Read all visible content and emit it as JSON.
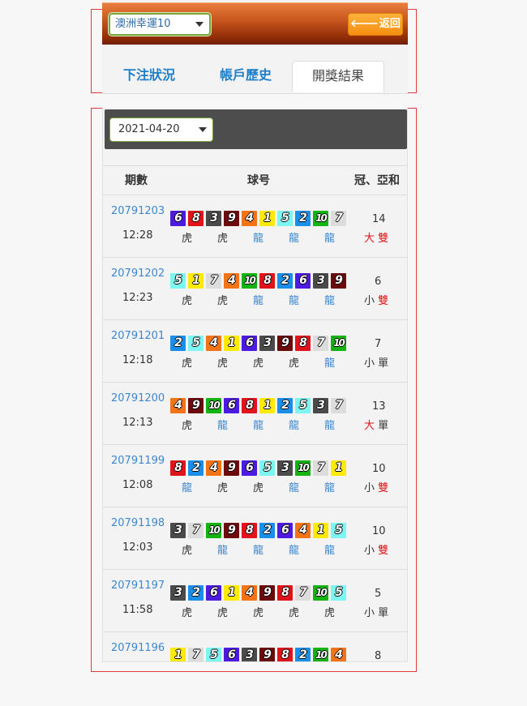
{
  "header": {
    "lottery_select": "澳洲幸運10",
    "back_label": "返回"
  },
  "tabs": [
    {
      "label": "下注狀況"
    },
    {
      "label": "帳戶歷史"
    },
    {
      "label": "開獎結果"
    }
  ],
  "toolbar": {
    "date_value": "2021-04-20"
  },
  "table": {
    "headers": {
      "period": "期數",
      "balls": "球号",
      "sum": "冠、亞和"
    },
    "rows": [
      {
        "period": "20791203",
        "time": "12:28",
        "balls": [
          6,
          8,
          3,
          9,
          4,
          1,
          5,
          2,
          10,
          7
        ],
        "dt": [
          "虎",
          "虎",
          "龍",
          "龍",
          "龍"
        ],
        "sum": "14",
        "size": "大",
        "oe": "雙"
      },
      {
        "period": "20791202",
        "time": "12:23",
        "balls": [
          5,
          1,
          7,
          4,
          10,
          8,
          2,
          6,
          3,
          9
        ],
        "dt": [
          "虎",
          "虎",
          "龍",
          "龍",
          "龍"
        ],
        "sum": "6",
        "size": "小",
        "oe": "雙"
      },
      {
        "period": "20791201",
        "time": "12:18",
        "balls": [
          2,
          5,
          4,
          1,
          6,
          3,
          9,
          8,
          7,
          10
        ],
        "dt": [
          "虎",
          "虎",
          "虎",
          "虎",
          "龍"
        ],
        "sum": "7",
        "size": "小",
        "oe": "單"
      },
      {
        "period": "20791200",
        "time": "12:13",
        "balls": [
          4,
          9,
          10,
          6,
          8,
          1,
          2,
          5,
          3,
          7
        ],
        "dt": [
          "虎",
          "龍",
          "龍",
          "龍",
          "龍"
        ],
        "sum": "13",
        "size": "大",
        "oe": "單"
      },
      {
        "period": "20791199",
        "time": "12:08",
        "balls": [
          8,
          2,
          4,
          9,
          6,
          5,
          3,
          10,
          7,
          1
        ],
        "dt": [
          "龍",
          "虎",
          "虎",
          "龍",
          "龍"
        ],
        "sum": "10",
        "size": "小",
        "oe": "雙"
      },
      {
        "period": "20791198",
        "time": "12:03",
        "balls": [
          3,
          7,
          10,
          9,
          8,
          2,
          6,
          4,
          1,
          5
        ],
        "dt": [
          "虎",
          "龍",
          "龍",
          "龍",
          "龍"
        ],
        "sum": "10",
        "size": "小",
        "oe": "雙"
      },
      {
        "period": "20791197",
        "time": "11:58",
        "balls": [
          3,
          2,
          6,
          1,
          4,
          9,
          8,
          7,
          10,
          5
        ],
        "dt": [
          "虎",
          "虎",
          "虎",
          "虎",
          "虎"
        ],
        "sum": "5",
        "size": "小",
        "oe": "單"
      },
      {
        "period": "20791196",
        "time": "",
        "balls": [
          1,
          7,
          5,
          6,
          3,
          9,
          8,
          2,
          10,
          4
        ],
        "dt": [],
        "sum": "8",
        "size": "",
        "oe": ""
      }
    ]
  }
}
